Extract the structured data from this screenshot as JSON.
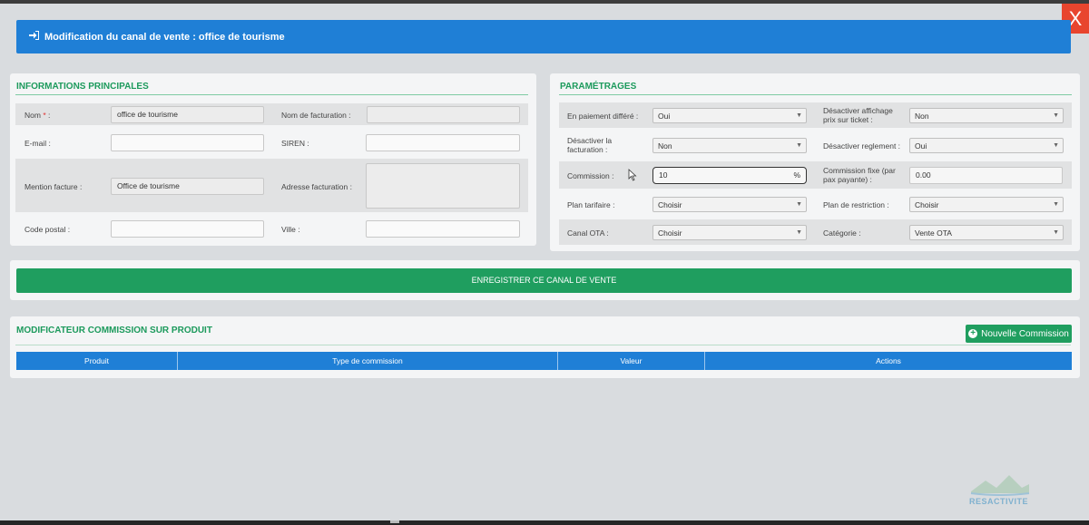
{
  "modal": {
    "close_label": "X",
    "title": "Modification du canal de vente : office de tourisme"
  },
  "infos": {
    "heading": "INFORMATIONS PRINCIPALES",
    "nom_label": "Nom ",
    "nom_required": "*",
    "nom_suffix": " :",
    "nom_value": "office de tourisme",
    "nom_facturation_label": "Nom de facturation :",
    "nom_facturation_value": "",
    "email_label": "E-mail :",
    "email_value": "",
    "siren_label": "SIREN :",
    "siren_value": "",
    "mention_label": "Mention facture :",
    "mention_value": "Office de tourisme",
    "adresse_label": "Adresse facturation :",
    "adresse_value": "",
    "cp_label": "Code postal :",
    "cp_value": "",
    "ville_label": "Ville :",
    "ville_value": ""
  },
  "params": {
    "heading": "PARAMÉTRAGES",
    "paiement_label": "En paiement différé :",
    "paiement_value": "Oui",
    "desact_affichage_label_1": "Désactiver affichage",
    "desact_affichage_label_2": "prix sur ticket :",
    "desact_affichage_value": "Non",
    "desact_fact_label_1": "Désactiver la",
    "desact_fact_label_2": "facturation :",
    "desact_fact_value": "Non",
    "desact_reglement_label": "Désactiver reglement :",
    "desact_reglement_value": "Oui",
    "commission_label": "Commission :",
    "commission_value": "10",
    "commission_suffix": "%",
    "commission_fixe_label_1": "Commission fixe (par",
    "commission_fixe_label_2": "pax payante) :",
    "commission_fixe_value": "0.00",
    "plan_tarifaire_label": "Plan tarifaire :",
    "plan_tarifaire_value": "Choisir",
    "plan_restriction_label": "Plan de restriction :",
    "plan_restriction_value": "Choisir",
    "canal_ota_label": "Canal OTA :",
    "canal_ota_value": "Choisir",
    "categorie_label": "Catégorie :",
    "categorie_value": "Vente OTA"
  },
  "save_button": "ENREGISTRER CE CANAL DE VENTE",
  "modificateur": {
    "heading": "MODIFICATEUR COMMISSION SUR PRODUIT",
    "new_button": "Nouvelle Commission",
    "columns": [
      "Produit",
      "Type de commission",
      "Valeur",
      "Actions"
    ]
  },
  "logo": {
    "text": "RESACTIVITE"
  },
  "colors": {
    "primary_blue": "#1f7fd6",
    "green": "#1f9e5f",
    "close_red": "#e8452e"
  }
}
